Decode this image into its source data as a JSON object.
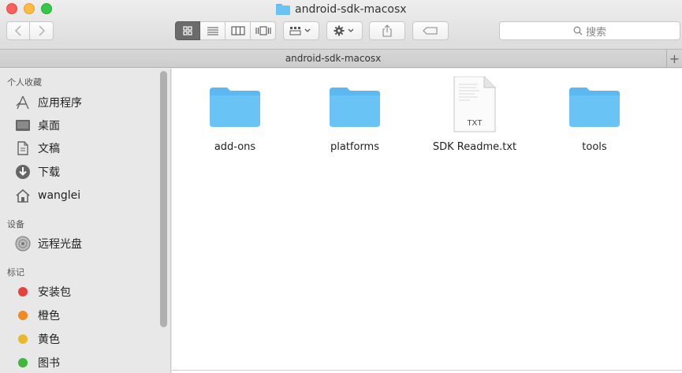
{
  "window": {
    "title": "android-sdk-macosx"
  },
  "toolbar": {
    "search_placeholder": "搜索",
    "view_modes": [
      "icon-view",
      "list-view",
      "column-view",
      "cover-flow-view"
    ]
  },
  "pathbar": {
    "title": "android-sdk-macosx",
    "plus": "+"
  },
  "sidebar": {
    "favorites_header": "个人收藏",
    "favorites": [
      {
        "label": "应用程序",
        "icon": "applications-icon"
      },
      {
        "label": "桌面",
        "icon": "desktop-icon"
      },
      {
        "label": "文稿",
        "icon": "documents-icon"
      },
      {
        "label": "下载",
        "icon": "downloads-icon"
      },
      {
        "label": "wanglei",
        "icon": "home-icon"
      }
    ],
    "devices_header": "设备",
    "devices": [
      {
        "label": "远程光盘",
        "icon": "remote-disc-icon"
      }
    ],
    "tags_header": "标记",
    "tags": [
      {
        "label": "安装包",
        "color": "#e8413d"
      },
      {
        "label": "橙色",
        "color": "#f08a24"
      },
      {
        "label": "黄色",
        "color": "#e8b92d"
      },
      {
        "label": "图书",
        "color": "#3fb63c"
      }
    ]
  },
  "files": [
    {
      "name": "add-ons",
      "kind": "folder"
    },
    {
      "name": "platforms",
      "kind": "folder"
    },
    {
      "name": "SDK Readme.txt",
      "kind": "text",
      "badge": "TXT"
    },
    {
      "name": "tools",
      "kind": "folder"
    }
  ],
  "colors": {
    "folder": "#6ac3f5",
    "folder_tab": "#5cb8f0"
  }
}
